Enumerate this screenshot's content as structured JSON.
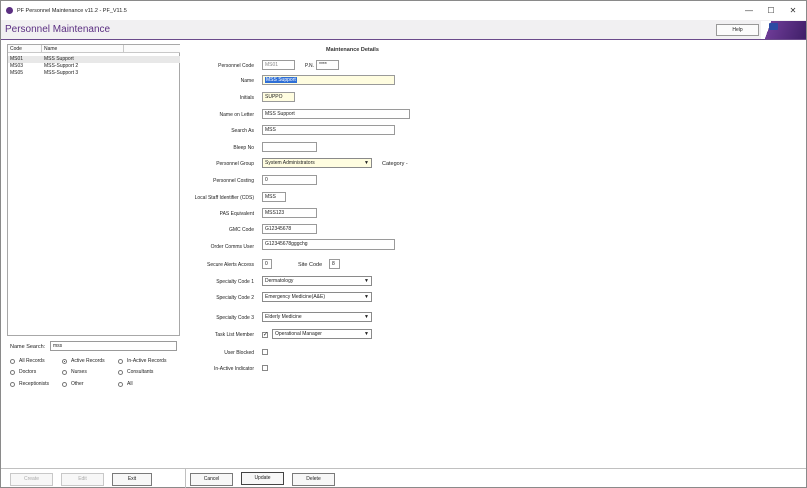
{
  "window": {
    "title": "PF Personnel Maintenance v11.2 - PF_V11.5",
    "minimize": "—",
    "maximize": "☐",
    "close": "✕"
  },
  "header": {
    "page_title": "Personnel Maintenance",
    "help_label": "Help"
  },
  "list": {
    "columns": [
      "Code",
      "Name"
    ],
    "rows": [
      {
        "code": "MS01",
        "name": "MSS Support"
      },
      {
        "code": "MS03",
        "name": "MSS-Support 2"
      },
      {
        "code": "MS05",
        "name": "MSS-Support 3"
      }
    ]
  },
  "search": {
    "label": "Name Search:",
    "value": "mss"
  },
  "filters": [
    {
      "label": "All Records",
      "selected": false
    },
    {
      "label": "Active Records",
      "selected": true
    },
    {
      "label": "In-Active Records",
      "selected": false
    },
    {
      "label": "Doctors",
      "selected": false
    },
    {
      "label": "Nurses",
      "selected": false
    },
    {
      "label": "Consultants",
      "selected": false
    },
    {
      "label": "Receptionists",
      "selected": false
    },
    {
      "label": "Other",
      "selected": false
    },
    {
      "label": "All",
      "selected": false
    }
  ],
  "left_buttons": {
    "create": "Create",
    "edit": "Edit",
    "exit": "Exit"
  },
  "form": {
    "section_title": "Maintenance Details",
    "personnel_code_label": "Personnel Code",
    "personnel_code": "MS01",
    "pin_label": "P.N.",
    "pin": "****",
    "name_label": "Name",
    "name": "MSS Support",
    "initials_label": "Initials",
    "initials": "SUPPO",
    "name_on_letter_label": "Name on Letter",
    "name_on_letter": "MSS Support",
    "search_as_label": "Search As",
    "search_as": "MSS",
    "bleep_label": "Bleep No",
    "bleep": "",
    "group_label": "Personnel Group",
    "group": "System Administrators",
    "category_label": "Category -",
    "costing_label": "Personnel Costing",
    "costing": "0",
    "local_staff_label": "Local Staff Identifier (CDS)",
    "local_staff": "MSS",
    "pas_label": "PAS Equivalent",
    "pas": "MSS123",
    "gmc_label": "GMC Code",
    "gmc": "G12345678",
    "order_comms_label": "Order Comms User",
    "order_comms": "G12345678gggchg",
    "secure_alerts_label": "Secure Alerts Access",
    "secure_alerts": "0",
    "site_code_label": "Site Code",
    "site_code": "8",
    "specialty1_label": "Specialty Code 1",
    "specialty1": "Dermatology",
    "specialty2_label": "Specialty Code 2",
    "specialty2": "Emergency Medicine(A&E)",
    "specialty3_label": "Specialty Code 3",
    "specialty3": "Elderly Medicine",
    "task_list_label": "Task List Member",
    "task_list_checked": true,
    "task_list_value": "Operational Manager",
    "user_blocked_label": "User Blocked",
    "user_blocked_checked": false,
    "inactive_label": "In-Active Indicator",
    "inactive_checked": false
  },
  "bottom_buttons": {
    "cancel": "Cancel",
    "update": "Update",
    "delete": "Delete"
  },
  "colors": {
    "brand": "#5b2f82",
    "highlight": "#2f6fd6",
    "required_field": "#fffde0"
  }
}
